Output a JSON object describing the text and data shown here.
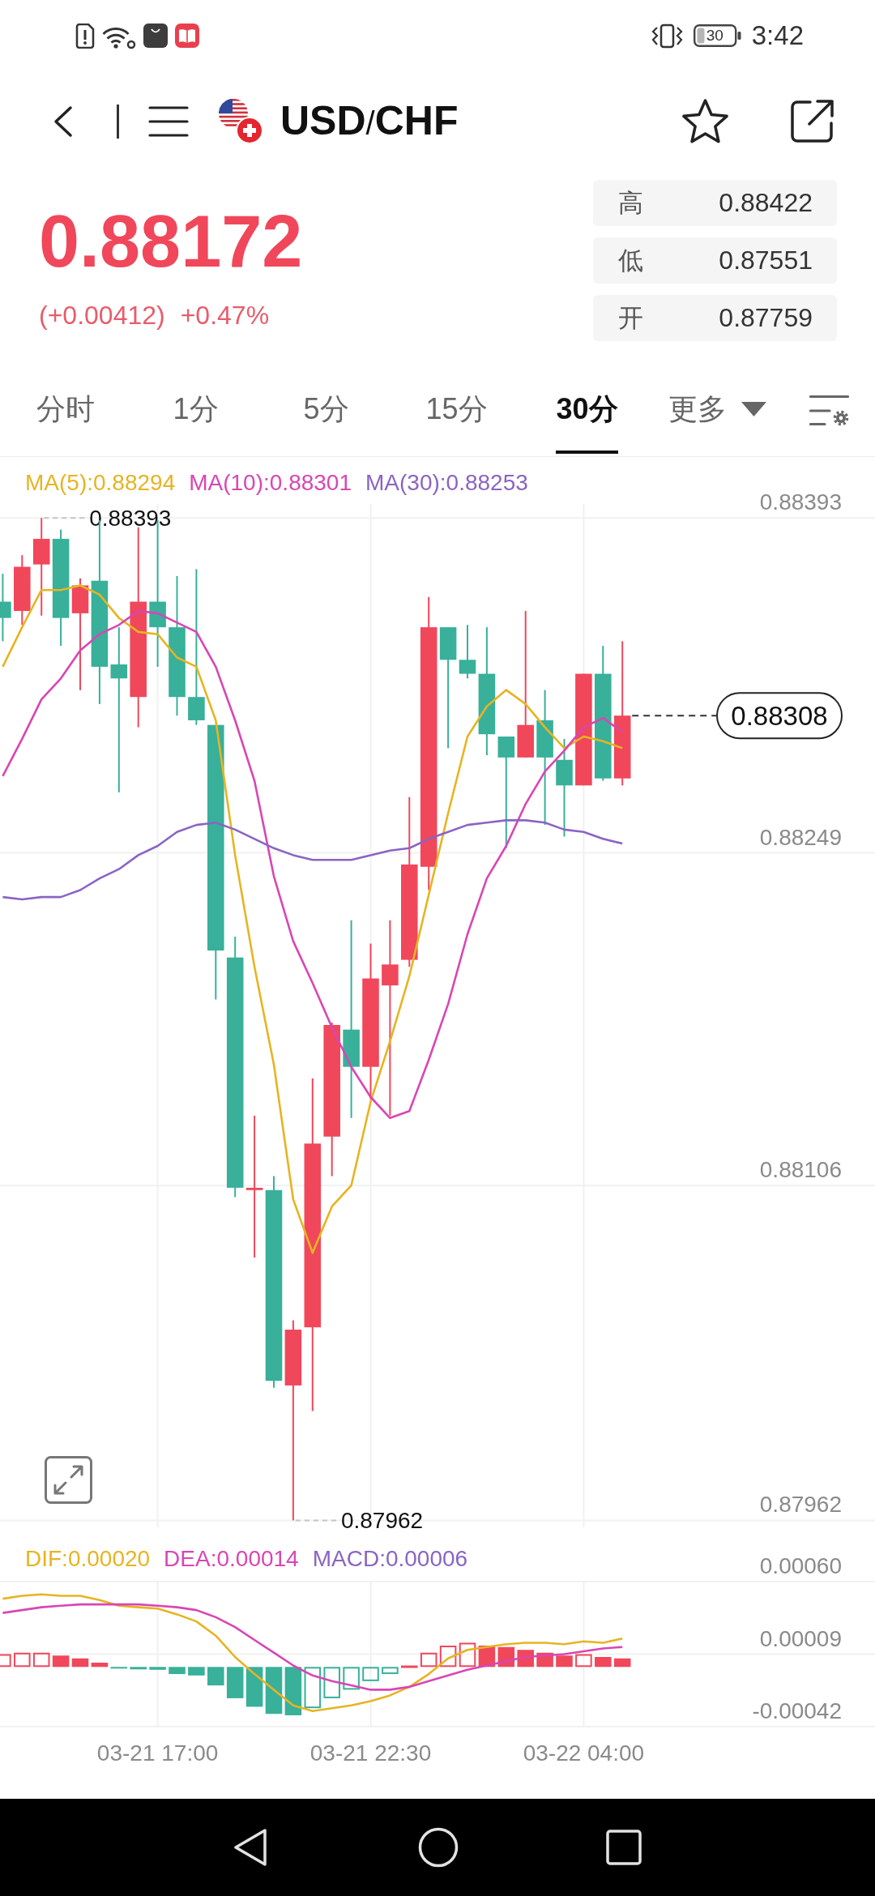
{
  "status_bar": {
    "battery": "30",
    "time": "3:42"
  },
  "header": {
    "title": "**USD**/**CHF**"
  },
  "quote": {
    "price": "0.88172",
    "change": "(+0.00412)",
    "change_percent": "+0.47%",
    "stats": [
      {
        "label": "高",
        "value": "0.88422"
      },
      {
        "label": "低",
        "value": "0.87551"
      },
      {
        "label": "开",
        "value": "0.87759"
      }
    ]
  },
  "tabs": [
    {
      "label": "分时",
      "kind": "tab",
      "selected": false
    },
    {
      "label": "1分",
      "kind": "tab",
      "selected": false
    },
    {
      "label": "5分",
      "kind": "tab",
      "selected": false
    },
    {
      "label": "15分",
      "kind": "tab",
      "selected": false
    },
    {
      "label": "30分",
      "kind": "tab",
      "selected": true
    },
    {
      "label": "更多",
      "kind": "dropdown",
      "selected": false
    }
  ],
  "main_chart": {
    "chart_data": {
      "type": "candlestick",
      "grid": true,
      "ylim": [
        0.87959,
        0.88399
      ],
      "yticks": [
        {
          "value": 0.88393,
          "label": "0.88393"
        },
        {
          "value": 0.88249,
          "label": "0.88249"
        },
        {
          "value": 0.88106,
          "label": "0.88106"
        },
        {
          "value": 0.87962,
          "label": "0.87962"
        }
      ],
      "series": [
        {
          "ohlc": [
            [
              0.88357,
              0.88369,
              0.8834,
              0.8835
            ],
            [
              0.88353,
              0.88377,
              0.88347,
              0.88372
            ],
            [
              0.88373,
              0.88393,
              0.88351,
              0.88384
            ],
            [
              0.88384,
              0.88388,
              0.88338,
              0.8835
            ],
            [
              0.88352,
              0.88367,
              0.88319,
              0.88364
            ],
            [
              0.88366,
              0.88392,
              0.88313,
              0.88329
            ],
            [
              0.8833,
              0.88346,
              0.88275,
              0.88324
            ],
            [
              0.88316,
              0.88389,
              0.88303,
              0.88357
            ],
            [
              0.88357,
              0.88392,
              0.88329,
              0.88346
            ],
            [
              0.88346,
              0.88368,
              0.88308,
              0.88316
            ],
            [
              0.88316,
              0.88371,
              0.88304,
              0.88306
            ],
            [
              0.88304,
              0.88304,
              0.88186,
              0.88207
            ],
            [
              0.88204,
              0.88213,
              0.88101,
              0.88105
            ],
            [
              0.88104,
              0.88136,
              0.88075,
              0.88105
            ],
            [
              0.88104,
              0.8811,
              0.88019,
              0.88022
            ],
            [
              0.8802,
              0.88048,
              0.87962,
              0.88044
            ],
            [
              0.88045,
              0.88152,
              0.88009,
              0.88124
            ],
            [
              0.88127,
              0.88176,
              0.8811,
              0.88175
            ],
            [
              0.88173,
              0.8822,
              0.88135,
              0.88157
            ],
            [
              0.88157,
              0.8821,
              0.88143,
              0.88195
            ],
            [
              0.88192,
              0.8822,
              0.88136,
              0.88201
            ],
            [
              0.88203,
              0.88273,
              0.882,
              0.88244
            ],
            [
              0.88243,
              0.88359,
              0.88233,
              0.88346
            ],
            [
              0.88346,
              0.88346,
              0.88294,
              0.88332
            ],
            [
              0.88332,
              0.88347,
              0.88324,
              0.88326
            ],
            [
              0.88326,
              0.88346,
              0.88291,
              0.883
            ],
            [
              0.88299,
              0.88299,
              0.88251,
              0.8829
            ],
            [
              0.8829,
              0.88353,
              0.8829,
              0.88304
            ],
            [
              0.88306,
              0.88319,
              0.88261,
              0.8829
            ],
            [
              0.88289,
              0.88298,
              0.88256,
              0.88278
            ],
            [
              0.88278,
              0.88326,
              0.88278,
              0.88326
            ],
            [
              0.88326,
              0.88338,
              0.8828,
              0.88281
            ],
            [
              0.88281,
              0.8834,
              0.88278,
              0.88308
            ]
          ]
        },
        {
          "name": "MA(5):0.88294",
          "type": "line",
          "color": "#e6b422",
          "values": [
            0.88329,
            0.88346,
            0.88362,
            0.88362,
            0.88364,
            0.8836,
            0.8835,
            0.88344,
            0.88343,
            0.88333,
            0.88329,
            0.88306,
            0.88248,
            0.882,
            0.88158,
            0.881,
            0.88077,
            0.88097,
            0.88106,
            0.88142,
            0.88168,
            0.88196,
            0.88231,
            0.88266,
            0.88299,
            0.88312,
            0.88319,
            0.88313,
            0.88303,
            0.88294,
            0.88299,
            0.88297,
            0.88294
          ]
        },
        {
          "name": "MA(10):0.88301",
          "type": "line",
          "color": "#d846b4",
          "values": [
            0.88282,
            0.88298,
            0.88315,
            0.88324,
            0.88336,
            0.88343,
            0.88347,
            0.88353,
            0.88352,
            0.88348,
            0.88344,
            0.88329,
            0.88306,
            0.8828,
            0.88239,
            0.88211,
            0.88193,
            0.88174,
            0.88157,
            0.88144,
            0.88135,
            0.88138,
            0.8816,
            0.88184,
            0.88214,
            0.88238,
            0.88252,
            0.8827,
            0.88284,
            0.88293,
            0.88303,
            0.88307,
            0.88301
          ]
        },
        {
          "name": "MA(30):0.88253",
          "type": "line",
          "color": "#8a64c3",
          "values": [
            0.8823,
            0.88229,
            0.8823,
            0.8823,
            0.88233,
            0.88238,
            0.88242,
            0.88248,
            0.88252,
            0.88258,
            0.88261,
            0.88262,
            0.88259,
            0.88255,
            0.88251,
            0.88248,
            0.88246,
            0.88246,
            0.88246,
            0.88248,
            0.8825,
            0.88251,
            0.88255,
            0.88258,
            0.88261,
            0.88262,
            0.88263,
            0.88263,
            0.88262,
            0.88259,
            0.88258,
            0.88255,
            0.88253
          ]
        }
      ],
      "annotations": [
        "0.88393",
        "0.87962"
      ],
      "ref_lines": [
        {
          "label": "0.88308"
        }
      ]
    }
  },
  "macd_chart": {
    "legend": [
      {
        "text": "DIF:0.00020",
        "color": "#e6b422"
      },
      {
        "text": "DEA:0.00014",
        "color": "#d846b4"
      },
      {
        "text": "MACD:0.00006",
        "color": "#8a64c3"
      }
    ],
    "chart_data": {
      "type": "bar",
      "grid": true,
      "categories": [
        null,
        null,
        null,
        null,
        null,
        null,
        null,
        null,
        "03-21 17:00",
        null,
        null,
        null,
        null,
        null,
        null,
        null,
        null,
        null,
        null,
        "03-21 22:30",
        null,
        null,
        null,
        null,
        null,
        null,
        null,
        null,
        null,
        null,
        "03-22 04:00",
        null,
        null
      ],
      "ylim": [
        -0.00042,
        0.0006
      ],
      "yticks": [
        {
          "value": 0.0006,
          "label": "0.00060"
        },
        {
          "value": 9e-05,
          "label": "0.00009"
        },
        {
          "value": -0.00042,
          "label": "-0.00042"
        }
      ],
      "series": [
        {
          "type": "line",
          "color": "#e6b422",
          "values": [
            0.00048,
            0.0005,
            0.00051,
            0.0005,
            0.0005,
            0.00047,
            0.00043,
            0.00042,
            0.00041,
            0.00037,
            0.00032,
            0.00022,
            7e-05,
            -5e-05,
            -0.00016,
            -0.00027,
            -0.00031,
            -0.00029,
            -0.00027,
            -0.00024,
            -0.0002,
            -0.00014,
            -5e-05,
            6e-05,
            0.00012,
            0.00014,
            0.00016,
            0.00017,
            0.00017,
            0.00016,
            0.00018,
            0.00017,
            0.0002
          ]
        },
        {
          "type": "line",
          "color": "#d846b4",
          "values": [
            0.00038,
            0.0004,
            0.00042,
            0.00043,
            0.00044,
            0.00044,
            0.00044,
            0.00044,
            0.00043,
            0.00042,
            0.0004,
            0.00035,
            0.00028,
            0.00019,
            0.0001,
            1e-05,
            -6e-05,
            -0.0001,
            -0.00013,
            -0.00016,
            -0.00016,
            -0.00014,
            -0.0001,
            -6e-05,
            -2e-05,
            1e-05,
            4e-05,
            7e-05,
            8e-05,
            9e-05,
            0.00011,
            0.00013,
            0.00014
          ]
        },
        {
          "values": [
            9e-05,
            0.0001,
            0.0001,
            8e-05,
            6e-05,
            3e-05,
            -1e-05,
            -1e-05,
            -2e-05,
            -5e-05,
            -6e-05,
            -0.00013,
            -0.00022,
            -0.00028,
            -0.00033,
            -0.00034,
            -0.00029,
            -0.00022,
            -0.00016,
            -0.0001,
            -5e-05,
            1e-05,
            0.0001,
            0.00015,
            0.00017,
            0.00015,
            0.00014,
            0.00012,
            0.0001,
            8e-05,
            9e-05,
            7e-05,
            6e-05
          ],
          "colors": [
            "#f0475b",
            "#f0475b",
            "#f0475b",
            "#f0475b",
            "#f0475b",
            "#f0475b",
            "#38b09a",
            "#38b09a",
            "#38b09a",
            "#38b09a",
            "#38b09a",
            "#38b09a",
            "#38b09a",
            "#38b09a",
            "#38b09a",
            "#38b09a",
            "#38b09a",
            "#38b09a",
            "#38b09a",
            "#38b09a",
            "#38b09a",
            "#f0475b",
            "#f0475b",
            "#f0475b",
            "#f0475b",
            "#f0475b",
            "#f0475b",
            "#f0475b",
            "#f0475b",
            "#f0475b",
            "#f0475b",
            "#f0475b",
            "#f0475b"
          ]
        }
      ]
    }
  }
}
